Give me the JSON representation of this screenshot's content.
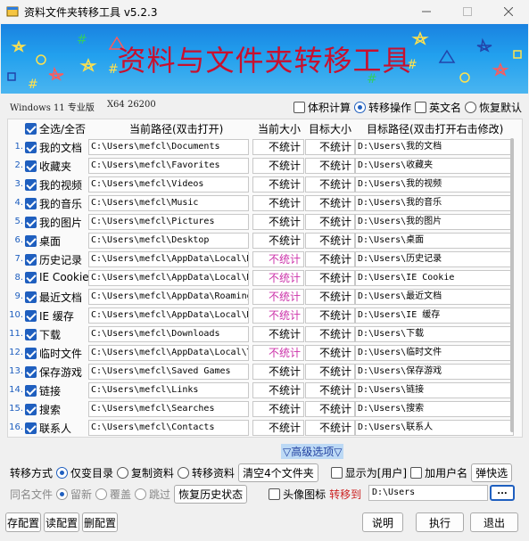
{
  "window": {
    "title": "资料文件夹转移工具 v5.2.3"
  },
  "banner": {
    "title": "资料与文件夹转移工具"
  },
  "system_info": {
    "os": "Windows 11 专业版",
    "arch": "X64 26200"
  },
  "options": {
    "volume_calc": {
      "label": "体积计算",
      "checked": false
    },
    "transfer_op": {
      "label": "转移操作",
      "selected": true
    },
    "english_name": {
      "label": "英文名",
      "checked": false
    },
    "restore_default": {
      "label": "恢复默认",
      "selected": false
    }
  },
  "columns": {
    "select_all": "全选/全否",
    "current_path": "当前路径(双击打开)",
    "current_size": "当前大小",
    "target_size": "目标大小",
    "target_path": "目标路径(双击打开右击修改)"
  },
  "rows": [
    {
      "num": "1.",
      "name": "我的文档",
      "cur": "C:\\Users\\mefcl\\Documents",
      "sz": "不统计",
      "tsz": "不统计",
      "tgt": "D:\\Users\\我的文档",
      "pink": false
    },
    {
      "num": "2.",
      "name": "收藏夹",
      "cur": "C:\\Users\\mefcl\\Favorites",
      "sz": "不统计",
      "tsz": "不统计",
      "tgt": "D:\\Users\\收藏夹",
      "pink": false
    },
    {
      "num": "3.",
      "name": "我的视频",
      "cur": "C:\\Users\\mefcl\\Videos",
      "sz": "不统计",
      "tsz": "不统计",
      "tgt": "D:\\Users\\我的视频",
      "pink": false
    },
    {
      "num": "4.",
      "name": "我的音乐",
      "cur": "C:\\Users\\mefcl\\Music",
      "sz": "不统计",
      "tsz": "不统计",
      "tgt": "D:\\Users\\我的音乐",
      "pink": false
    },
    {
      "num": "5.",
      "name": "我的图片",
      "cur": "C:\\Users\\mefcl\\Pictures",
      "sz": "不统计",
      "tsz": "不统计",
      "tgt": "D:\\Users\\我的图片",
      "pink": false
    },
    {
      "num": "6.",
      "name": "桌面",
      "cur": "C:\\Users\\mefcl\\Desktop",
      "sz": "不统计",
      "tsz": "不统计",
      "tgt": "D:\\Users\\桌面",
      "pink": false
    },
    {
      "num": "7.",
      "name": "历史记录",
      "cur": "C:\\Users\\mefcl\\AppData\\Local\\M",
      "sz": "不统计",
      "tsz": "不统计",
      "tgt": "D:\\Users\\历史记录",
      "pink": true
    },
    {
      "num": "8.",
      "name": "IE Cookie",
      "cur": "C:\\Users\\mefcl\\AppData\\Local\\M",
      "sz": "不统计",
      "tsz": "不统计",
      "tgt": "D:\\Users\\IE Cookie",
      "pink": true
    },
    {
      "num": "9.",
      "name": "最近文档",
      "cur": "C:\\Users\\mefcl\\AppData\\Roaming",
      "sz": "不统计",
      "tsz": "不统计",
      "tgt": "D:\\Users\\最近文档",
      "pink": true
    },
    {
      "num": "10.",
      "name": "IE 缓存",
      "cur": "C:\\Users\\mefcl\\AppData\\Local\\M",
      "sz": "不统计",
      "tsz": "不统计",
      "tgt": "D:\\Users\\IE 缓存",
      "pink": true
    },
    {
      "num": "11.",
      "name": "下载",
      "cur": "C:\\Users\\mefcl\\Downloads",
      "sz": "不统计",
      "tsz": "不统计",
      "tgt": "D:\\Users\\下载",
      "pink": false
    },
    {
      "num": "12.",
      "name": "临时文件",
      "cur": "C:\\Users\\mefcl\\AppData\\Local\\T",
      "sz": "不统计",
      "tsz": "不统计",
      "tgt": "D:\\Users\\临时文件",
      "pink": true
    },
    {
      "num": "13.",
      "name": "保存游戏",
      "cur": "C:\\Users\\mefcl\\Saved Games",
      "sz": "不统计",
      "tsz": "不统计",
      "tgt": "D:\\Users\\保存游戏",
      "pink": false
    },
    {
      "num": "14.",
      "name": "链接",
      "cur": "C:\\Users\\mefcl\\Links",
      "sz": "不统计",
      "tsz": "不统计",
      "tgt": "D:\\Users\\链接",
      "pink": false
    },
    {
      "num": "15.",
      "name": "搜索",
      "cur": "C:\\Users\\mefcl\\Searches",
      "sz": "不统计",
      "tsz": "不统计",
      "tgt": "D:\\Users\\搜索",
      "pink": false
    },
    {
      "num": "16.",
      "name": "联系人",
      "cur": "C:\\Users\\mefcl\\Contacts",
      "sz": "不统计",
      "tsz": "不统计",
      "tgt": "D:\\Users\\联系人",
      "pink": false
    }
  ],
  "advanced": "▽高级选项▽",
  "transfer_mode": {
    "label": "转移方式",
    "move_dir": "仅变目录",
    "copy_data": "复制资料",
    "move_data": "转移资料",
    "clear_btn": "清空4个文件夹",
    "show_user": "显示为[用户]",
    "add_user": "加用户名",
    "popup": "弹快选"
  },
  "same_name": {
    "label": "同名文件",
    "keep": "留新",
    "overwrite": "覆盖",
    "skip": "跳过",
    "restore_btn": "恢复历史状态",
    "avatar_icon": "头像图标",
    "transfer_to": "转移到",
    "target_value": "D:\\Users",
    "browse": "..."
  },
  "bottom": {
    "save_cfg": "存配置",
    "read_cfg": "读配置",
    "del_cfg": "删配置",
    "help": "说明",
    "execute": "执行",
    "exit": "退出"
  },
  "colors": {
    "accent": "#1f5fbf",
    "banner_title": "#c8102e",
    "pink_text": "#cc33aa"
  }
}
